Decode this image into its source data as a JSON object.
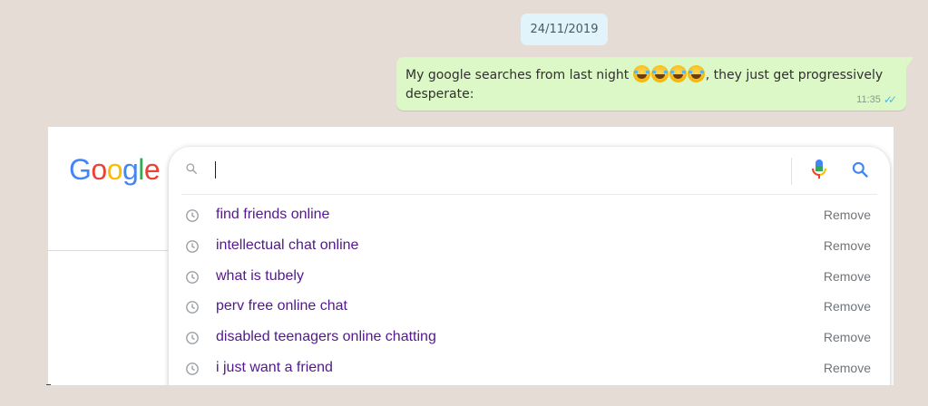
{
  "chat": {
    "date": "24/11/2019",
    "message": {
      "text_before": "My google searches from last night ",
      "emoji_count": 4,
      "emoji_name": "face-with-tears-of-joy",
      "text_after": ", they just get progressively desperate:",
      "time": "11:35",
      "status": "read"
    }
  },
  "google": {
    "logo_letters": [
      {
        "char": "G",
        "color": "#4285f4"
      },
      {
        "char": "o",
        "color": "#ea4335"
      },
      {
        "char": "o",
        "color": "#fbbc05"
      },
      {
        "char": "g",
        "color": "#4285f4"
      },
      {
        "char": "l",
        "color": "#34a853"
      },
      {
        "char": "e",
        "color": "#ea4335"
      }
    ],
    "search_value": "",
    "remove_label": "Remove",
    "suggestions": [
      {
        "text": "find friends online"
      },
      {
        "text": "intellectual chat online"
      },
      {
        "text": "what is tubely"
      },
      {
        "text": "perv free online chat"
      },
      {
        "text": "disabled teenagers online chatting"
      },
      {
        "text": "i just want a friend"
      }
    ]
  },
  "colors": {
    "chat_background": "#e5ddd5",
    "bubble": "#dcf8c6",
    "date_chip": "#e1f3fb",
    "visited_link": "#52188c",
    "ticks": "#4fb6ec"
  }
}
